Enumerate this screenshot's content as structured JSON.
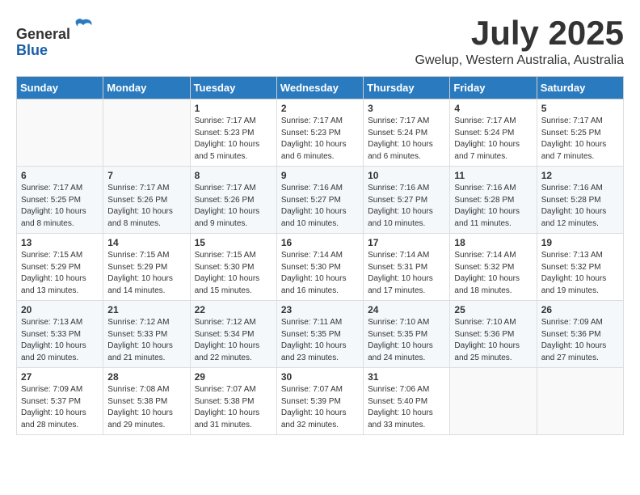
{
  "header": {
    "logo_line1": "General",
    "logo_line2": "Blue",
    "month": "July 2025",
    "location": "Gwelup, Western Australia, Australia"
  },
  "weekdays": [
    "Sunday",
    "Monday",
    "Tuesday",
    "Wednesday",
    "Thursday",
    "Friday",
    "Saturday"
  ],
  "weeks": [
    [
      {
        "day": "",
        "info": ""
      },
      {
        "day": "",
        "info": ""
      },
      {
        "day": "1",
        "info": "Sunrise: 7:17 AM\nSunset: 5:23 PM\nDaylight: 10 hours\nand 5 minutes."
      },
      {
        "day": "2",
        "info": "Sunrise: 7:17 AM\nSunset: 5:23 PM\nDaylight: 10 hours\nand 6 minutes."
      },
      {
        "day": "3",
        "info": "Sunrise: 7:17 AM\nSunset: 5:24 PM\nDaylight: 10 hours\nand 6 minutes."
      },
      {
        "day": "4",
        "info": "Sunrise: 7:17 AM\nSunset: 5:24 PM\nDaylight: 10 hours\nand 7 minutes."
      },
      {
        "day": "5",
        "info": "Sunrise: 7:17 AM\nSunset: 5:25 PM\nDaylight: 10 hours\nand 7 minutes."
      }
    ],
    [
      {
        "day": "6",
        "info": "Sunrise: 7:17 AM\nSunset: 5:25 PM\nDaylight: 10 hours\nand 8 minutes."
      },
      {
        "day": "7",
        "info": "Sunrise: 7:17 AM\nSunset: 5:26 PM\nDaylight: 10 hours\nand 8 minutes."
      },
      {
        "day": "8",
        "info": "Sunrise: 7:17 AM\nSunset: 5:26 PM\nDaylight: 10 hours\nand 9 minutes."
      },
      {
        "day": "9",
        "info": "Sunrise: 7:16 AM\nSunset: 5:27 PM\nDaylight: 10 hours\nand 10 minutes."
      },
      {
        "day": "10",
        "info": "Sunrise: 7:16 AM\nSunset: 5:27 PM\nDaylight: 10 hours\nand 10 minutes."
      },
      {
        "day": "11",
        "info": "Sunrise: 7:16 AM\nSunset: 5:28 PM\nDaylight: 10 hours\nand 11 minutes."
      },
      {
        "day": "12",
        "info": "Sunrise: 7:16 AM\nSunset: 5:28 PM\nDaylight: 10 hours\nand 12 minutes."
      }
    ],
    [
      {
        "day": "13",
        "info": "Sunrise: 7:15 AM\nSunset: 5:29 PM\nDaylight: 10 hours\nand 13 minutes."
      },
      {
        "day": "14",
        "info": "Sunrise: 7:15 AM\nSunset: 5:29 PM\nDaylight: 10 hours\nand 14 minutes."
      },
      {
        "day": "15",
        "info": "Sunrise: 7:15 AM\nSunset: 5:30 PM\nDaylight: 10 hours\nand 15 minutes."
      },
      {
        "day": "16",
        "info": "Sunrise: 7:14 AM\nSunset: 5:30 PM\nDaylight: 10 hours\nand 16 minutes."
      },
      {
        "day": "17",
        "info": "Sunrise: 7:14 AM\nSunset: 5:31 PM\nDaylight: 10 hours\nand 17 minutes."
      },
      {
        "day": "18",
        "info": "Sunrise: 7:14 AM\nSunset: 5:32 PM\nDaylight: 10 hours\nand 18 minutes."
      },
      {
        "day": "19",
        "info": "Sunrise: 7:13 AM\nSunset: 5:32 PM\nDaylight: 10 hours\nand 19 minutes."
      }
    ],
    [
      {
        "day": "20",
        "info": "Sunrise: 7:13 AM\nSunset: 5:33 PM\nDaylight: 10 hours\nand 20 minutes."
      },
      {
        "day": "21",
        "info": "Sunrise: 7:12 AM\nSunset: 5:33 PM\nDaylight: 10 hours\nand 21 minutes."
      },
      {
        "day": "22",
        "info": "Sunrise: 7:12 AM\nSunset: 5:34 PM\nDaylight: 10 hours\nand 22 minutes."
      },
      {
        "day": "23",
        "info": "Sunrise: 7:11 AM\nSunset: 5:35 PM\nDaylight: 10 hours\nand 23 minutes."
      },
      {
        "day": "24",
        "info": "Sunrise: 7:10 AM\nSunset: 5:35 PM\nDaylight: 10 hours\nand 24 minutes."
      },
      {
        "day": "25",
        "info": "Sunrise: 7:10 AM\nSunset: 5:36 PM\nDaylight: 10 hours\nand 25 minutes."
      },
      {
        "day": "26",
        "info": "Sunrise: 7:09 AM\nSunset: 5:36 PM\nDaylight: 10 hours\nand 27 minutes."
      }
    ],
    [
      {
        "day": "27",
        "info": "Sunrise: 7:09 AM\nSunset: 5:37 PM\nDaylight: 10 hours\nand 28 minutes."
      },
      {
        "day": "28",
        "info": "Sunrise: 7:08 AM\nSunset: 5:38 PM\nDaylight: 10 hours\nand 29 minutes."
      },
      {
        "day": "29",
        "info": "Sunrise: 7:07 AM\nSunset: 5:38 PM\nDaylight: 10 hours\nand 31 minutes."
      },
      {
        "day": "30",
        "info": "Sunrise: 7:07 AM\nSunset: 5:39 PM\nDaylight: 10 hours\nand 32 minutes."
      },
      {
        "day": "31",
        "info": "Sunrise: 7:06 AM\nSunset: 5:40 PM\nDaylight: 10 hours\nand 33 minutes."
      },
      {
        "day": "",
        "info": ""
      },
      {
        "day": "",
        "info": ""
      }
    ]
  ]
}
